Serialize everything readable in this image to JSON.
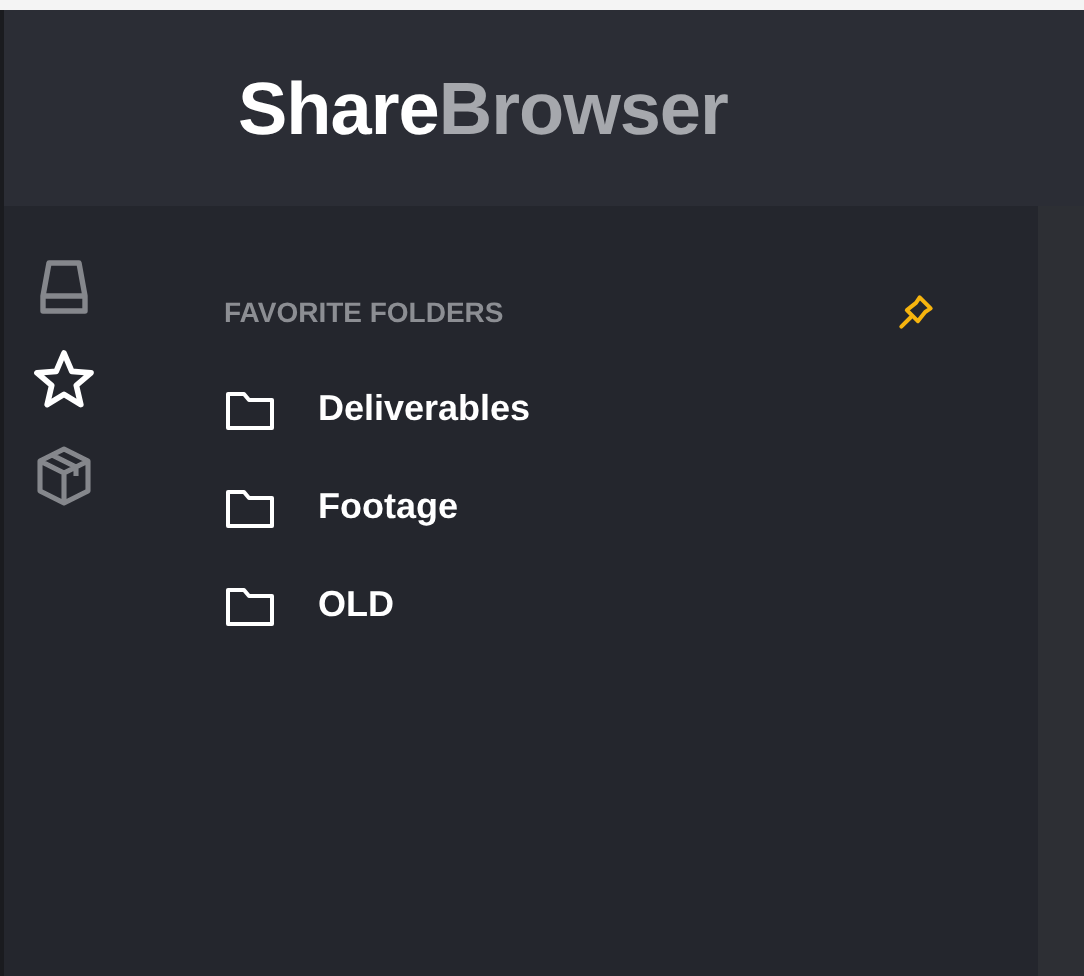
{
  "logo": {
    "first": "Share",
    "second": "Browser"
  },
  "nav": [
    {
      "kind": "drive",
      "selected": false
    },
    {
      "kind": "star",
      "selected": true
    },
    {
      "kind": "box",
      "selected": false
    }
  ],
  "panel": {
    "title": "FAVORITE FOLDERS",
    "pinned": true
  },
  "folders": [
    {
      "name": "Deliverables"
    },
    {
      "name": "Footage"
    },
    {
      "name": "OLD"
    }
  ]
}
